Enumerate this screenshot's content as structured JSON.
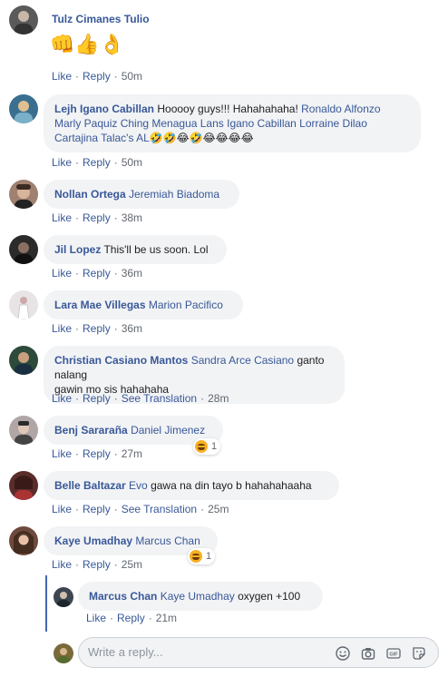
{
  "comments": [
    {
      "name": "Tulz Cimanes Tulio",
      "text": "",
      "emoji": "👊👍👌",
      "actions": {
        "like": "Like",
        "reply": "Reply",
        "time": "50m"
      },
      "avatar_color": "#5a5a5a"
    },
    {
      "name": "Lejh Igano Cabillan",
      "text_lines": [
        {
          "plain": "Hooooy guys!!! Hahahahaha! ",
          "tag": "Ronaldo Alfonzo"
        },
        {
          "plain": "",
          "tag": "Marly Paquiz Ching Menagua Lans Igano Cabillan Lorraine Dilao"
        },
        {
          "plain": "",
          "tag": "Cartajina Talac's AL",
          "emojis": "🤣🤣😂🤣😂😂😂😂"
        }
      ],
      "actions": {
        "like": "Like",
        "reply": "Reply",
        "time": "50m"
      },
      "avatar_color": "#3b6f8f"
    },
    {
      "name": "Nollan Ortega",
      "tag": "Jeremiah Biadoma",
      "text": "",
      "actions": {
        "like": "Like",
        "reply": "Reply",
        "time": "38m"
      },
      "avatar_color": "#a08070"
    },
    {
      "name": "Jil Lopez",
      "tag": "",
      "text": "This'll be us soon. Lol",
      "actions": {
        "like": "Like",
        "reply": "Reply",
        "time": "36m"
      },
      "avatar_color": "#2b2b2b"
    },
    {
      "name": "Lara Mae Villegas",
      "tag": "Marion Pacifico",
      "text": "",
      "actions": {
        "like": "Like",
        "reply": "Reply",
        "time": "36m"
      },
      "avatar_color": "#e8e4e6"
    },
    {
      "name": "Christian Casiano Mantos",
      "tag": "Sandra Arce Casiano",
      "text": " ganto nalang",
      "text2": "gawin mo sis hahahaha",
      "actions": {
        "like": "Like",
        "reply": "Reply",
        "translate": "See Translation",
        "time": "28m"
      },
      "avatar_color": "#2e4a3a"
    },
    {
      "name": "Benj Sararaña",
      "tag": "Daniel Jimenez",
      "text": "",
      "reaction_count": "1",
      "actions": {
        "like": "Like",
        "reply": "Reply",
        "time": "27m"
      },
      "avatar_color": "#b0a6a6"
    },
    {
      "name": "Belle Baltazar",
      "tag": "Evo",
      "text": " gawa na din tayo b hahahahaaha",
      "actions": {
        "like": "Like",
        "reply": "Reply",
        "translate": "See Translation",
        "time": "25m"
      },
      "avatar_color": "#5a2d2a"
    },
    {
      "name": "Kaye Umadhay",
      "tag": "Marcus Chan",
      "text": "",
      "reaction_count": "1",
      "actions": {
        "like": "Like",
        "reply": "Reply",
        "time": "25m"
      },
      "avatar_color": "#6e4a3c"
    }
  ],
  "reply": {
    "name": "Marcus Chan",
    "tag": "Kaye Umadhay",
    "text": " oxygen +100",
    "actions": {
      "like": "Like",
      "reply": "Reply",
      "time": "21m"
    },
    "avatar_color": "#3c4650"
  },
  "reply_box": {
    "placeholder": "Write a reply...",
    "icons": [
      "smiley-icon",
      "camera-icon",
      "gif-icon",
      "sticker-icon"
    ]
  },
  "colors": {
    "link": "#385898",
    "bubble": "#f2f3f5",
    "meta": "#606770",
    "thread_line": "#4267b2"
  }
}
